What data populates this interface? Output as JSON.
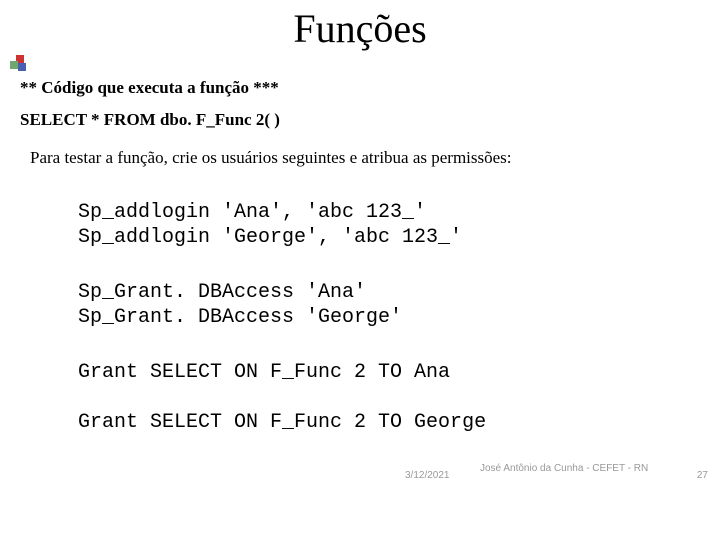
{
  "title": "Funções",
  "subtitle": "** Código que executa a função ***",
  "sql_line": "SELECT * FROM dbo. F_Func 2( )",
  "instruction": "Para testar a função, crie os usuários seguintes e atribua as permissões:",
  "code": {
    "block1": "Sp_addlogin 'Ana', 'abc 123_'\nSp_addlogin 'George', 'abc 123_'",
    "block2": "Sp_Grant. DBAccess 'Ana'\nSp_Grant. DBAccess 'George'",
    "block3": "Grant SELECT ON F_Func 2 TO Ana",
    "block4": "Grant SELECT ON F_Func 2 TO George"
  },
  "footer": {
    "date": "3/12/2021",
    "author": "José Antônio da Cunha - CEFET - RN",
    "page": "27"
  }
}
